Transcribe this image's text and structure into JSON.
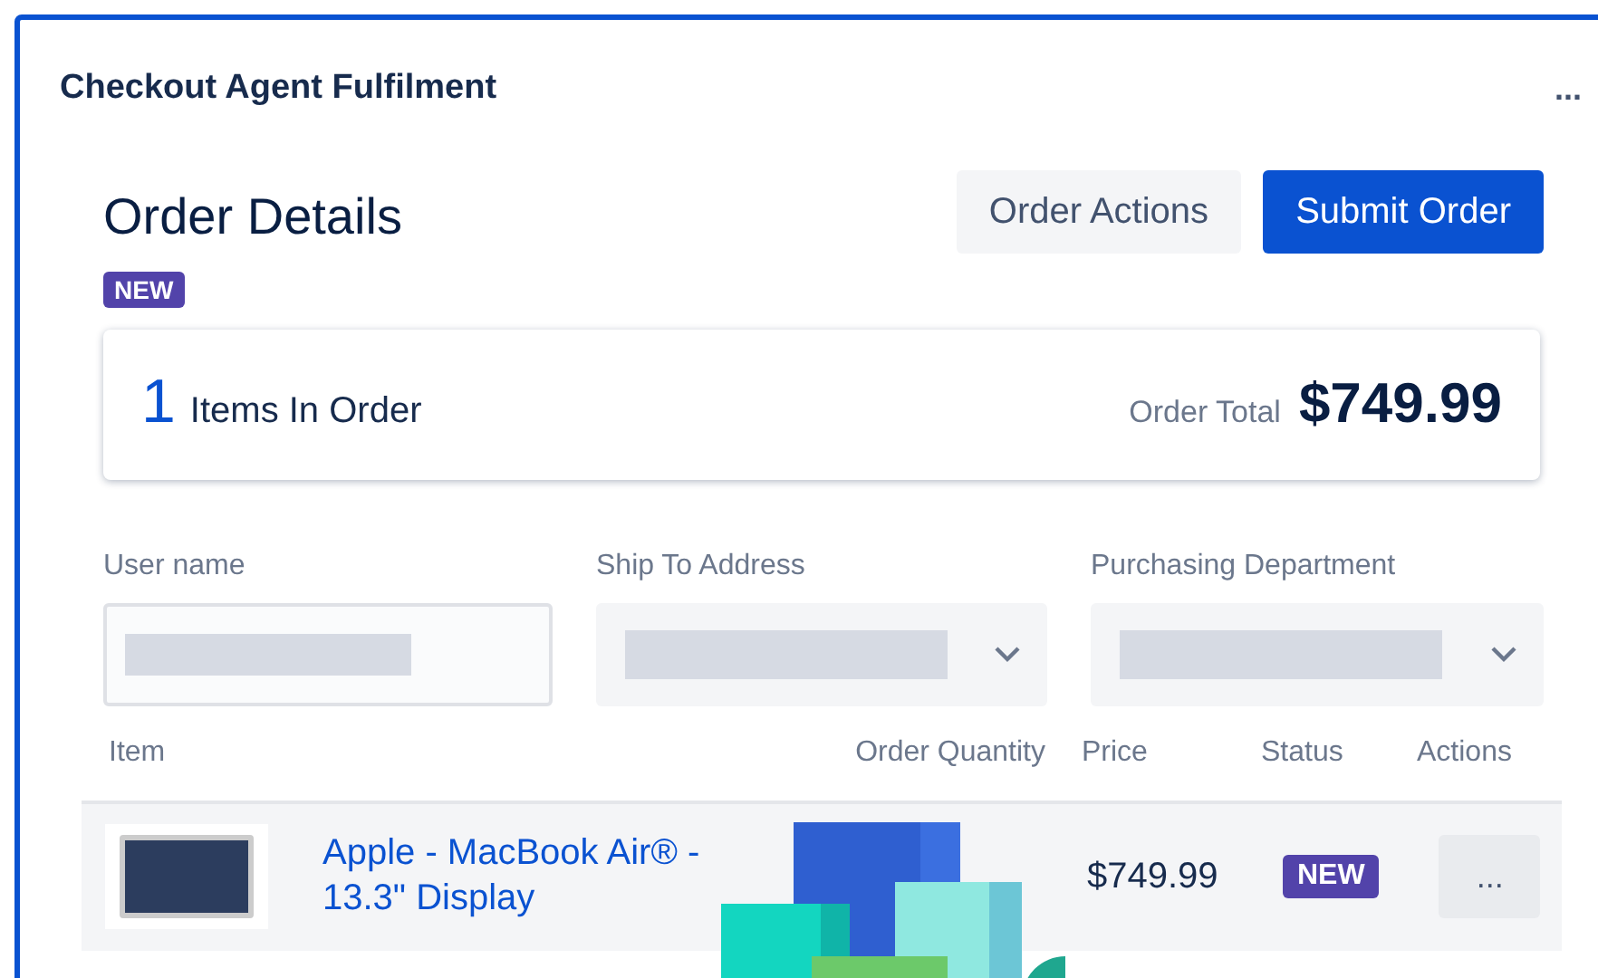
{
  "panel": {
    "title": "Checkout Agent Fulfilment",
    "menu": "..."
  },
  "order": {
    "heading": "Order Details",
    "badge": "NEW",
    "buttons": [
      {
        "label": "Order Actions",
        "kind": "secondary"
      },
      {
        "label": "Submit Order",
        "kind": "primary"
      }
    ]
  },
  "summary": {
    "count": "1",
    "count_label": "Items In Order",
    "total_label": "Order Total",
    "total": "$749.99"
  },
  "fields": [
    {
      "label": "User name",
      "kind": "text"
    },
    {
      "label": "Ship To Address",
      "kind": "select"
    },
    {
      "label": "Purchasing Department",
      "kind": "select"
    }
  ],
  "table": {
    "columns": [
      "Item",
      "Order Quantity",
      "Price",
      "Status",
      "Actions"
    ],
    "rows": [
      {
        "item": "Apple - MacBook Air® - 13.3\" Display",
        "price": "$749.99",
        "status": "NEW",
        "actions": "..."
      }
    ]
  }
}
